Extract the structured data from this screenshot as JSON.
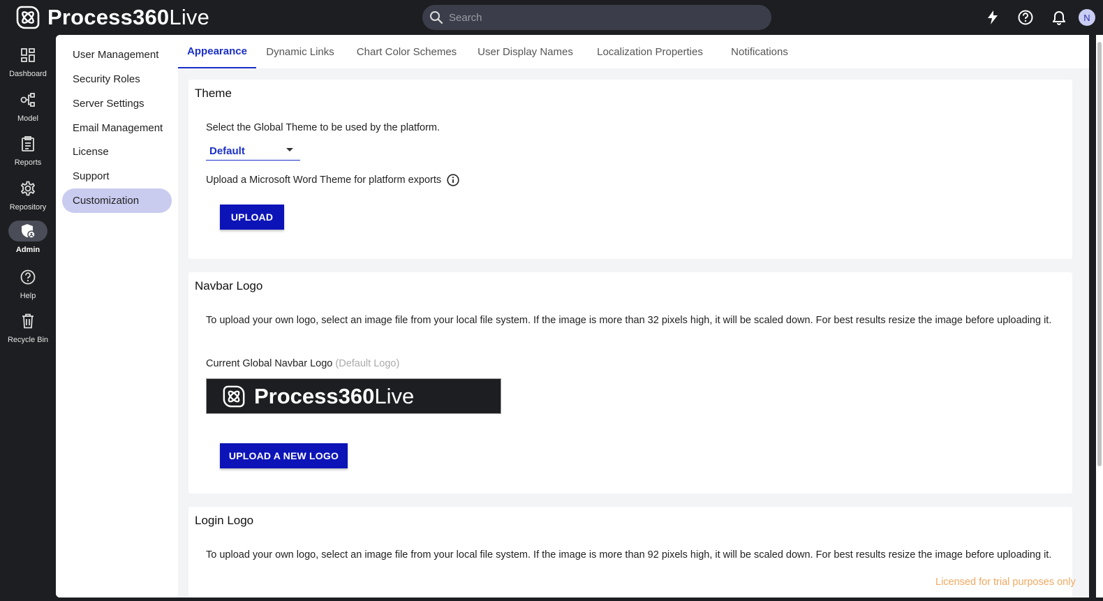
{
  "app": {
    "brand_bold": "Process360",
    "brand_light": "Live"
  },
  "search": {
    "placeholder": "Search"
  },
  "user": {
    "avatar_initial": "N"
  },
  "rail": [
    {
      "label": "Dashboard",
      "icon": "dashboard-icon"
    },
    {
      "label": "Model",
      "icon": "model-icon"
    },
    {
      "label": "Reports",
      "icon": "reports-icon"
    },
    {
      "label": "Repository",
      "icon": "gear-icon"
    },
    {
      "label": "Admin",
      "icon": "admin-shield-icon",
      "active": true
    },
    {
      "label": "Help",
      "icon": "help-icon"
    },
    {
      "label": "Recycle Bin",
      "icon": "trash-icon"
    }
  ],
  "subnav": [
    "User Management",
    "Security Roles",
    "Server Settings",
    "Email Management",
    "License",
    "Support",
    "Customization"
  ],
  "tabs": [
    "Appearance",
    "Dynamic Links",
    "Chart Color Schemes",
    "User Display Names",
    "Localization Properties",
    "Notifications"
  ],
  "theme": {
    "title": "Theme",
    "select_label": "Select the Global Theme to be used by the platform.",
    "selected": "Default",
    "word_label": "Upload a Microsoft Word Theme for platform exports",
    "upload_button": "UPLOAD"
  },
  "navbar_logo": {
    "title": "Navbar Logo",
    "description": "To upload your own logo, select an image file from your local file system. If the image is more than 32 pixels high, it will be scaled down. For best results resize the image before uploading it.",
    "current_label": "Current Global Navbar Logo",
    "current_hint": "(Default Logo)",
    "upload_button": "UPLOAD A NEW LOGO"
  },
  "login_logo": {
    "title": "Login Logo",
    "description": "To upload your own logo, select an image file from your local file system. If the image is more than 92 pixels high, it will be scaled down. For best results resize the image before uploading it."
  },
  "footer": {
    "license_text": "Licensed for trial purposes only"
  },
  "colors": {
    "accent": "#0c14b8",
    "topbar": "#1c1e21",
    "active_subnav": "#c9cbef",
    "license_text": "#f2a860"
  }
}
